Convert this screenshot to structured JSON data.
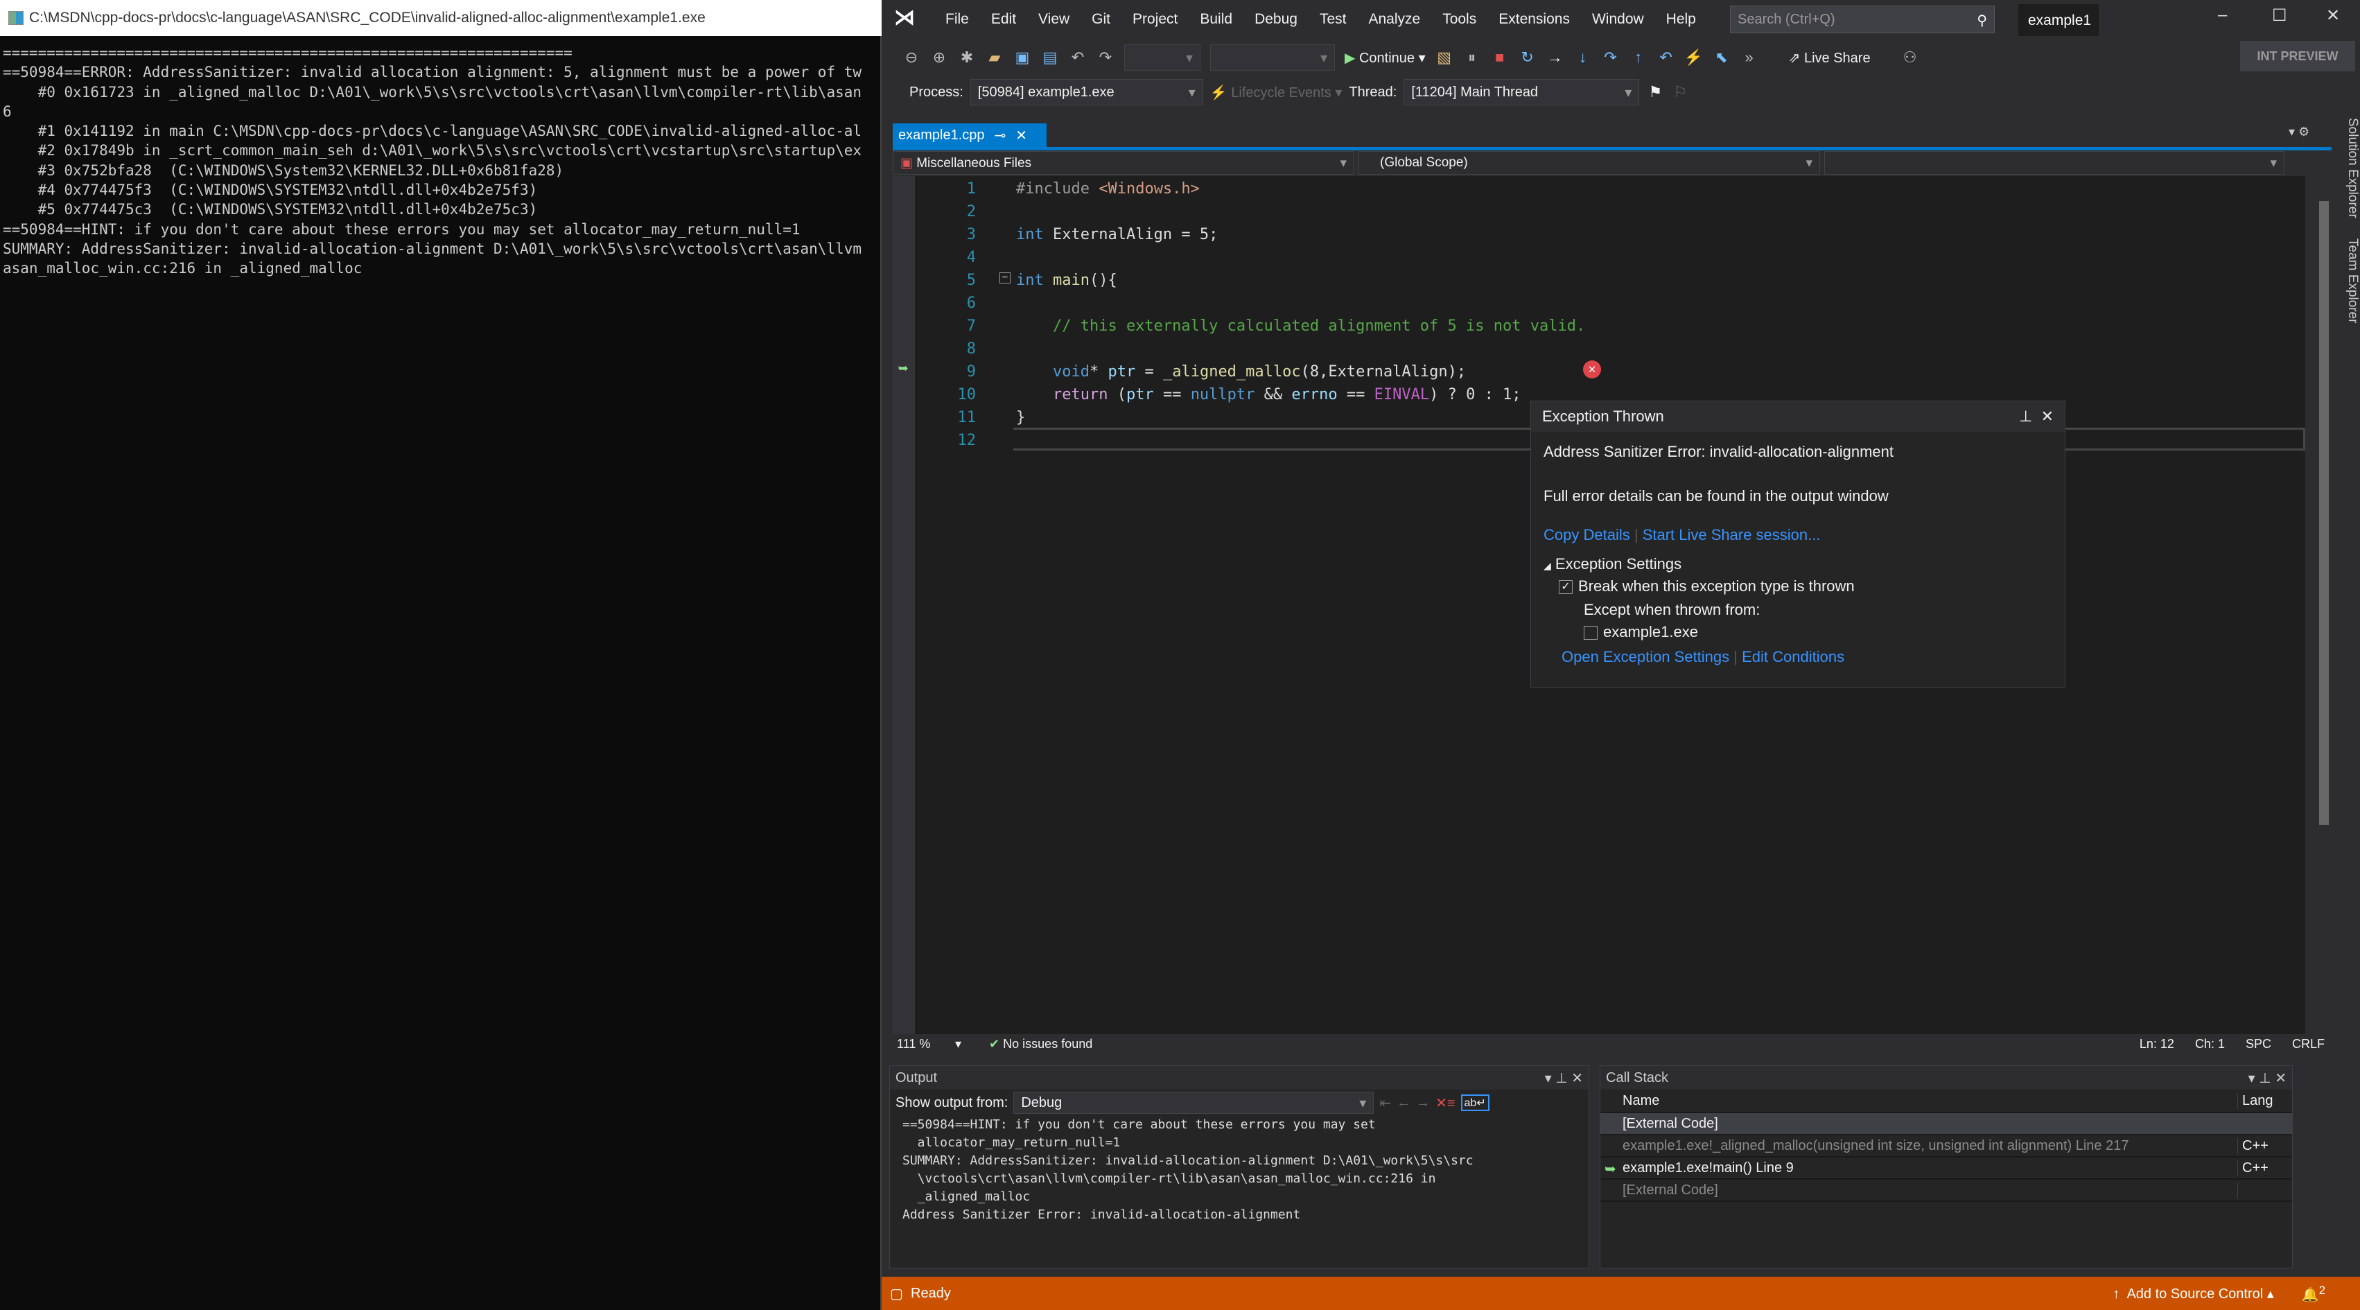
{
  "console": {
    "title": "C:\\MSDN\\cpp-docs-pr\\docs\\c-language\\ASAN\\SRC_CODE\\invalid-aligned-alloc-alignment\\example1.exe",
    "lines": [
      "=================================================================",
      "==50984==ERROR: AddressSanitizer: invalid allocation alignment: 5, alignment must be a power of tw",
      "    #0 0x161723 in _aligned_malloc D:\\A01\\_work\\5\\s\\src\\vctools\\crt\\asan\\llvm\\compiler-rt\\lib\\asan",
      "6",
      "    #1 0x141192 in main C:\\MSDN\\cpp-docs-pr\\docs\\c-language\\ASAN\\SRC_CODE\\invalid-aligned-alloc-al",
      "",
      "    #2 0x17849b in _scrt_common_main_seh d:\\A01\\_work\\5\\s\\src\\vctools\\crt\\vcstartup\\src\\startup\\ex",
      "    #3 0x752bfa28  (C:\\WINDOWS\\System32\\KERNEL32.DLL+0x6b81fa28)",
      "    #4 0x774475f3  (C:\\WINDOWS\\SYSTEM32\\ntdll.dll+0x4b2e75f3)",
      "    #5 0x774475c3  (C:\\WINDOWS\\SYSTEM32\\ntdll.dll+0x4b2e75c3)",
      "",
      "==50984==HINT: if you don't care about these errors you may set allocator_may_return_null=1",
      "SUMMARY: AddressSanitizer: invalid-allocation-alignment D:\\A01\\_work\\5\\s\\src\\vctools\\crt\\asan\\llvm",
      "asan_malloc_win.cc:216 in _aligned_malloc"
    ]
  },
  "vs": {
    "menu": [
      "File",
      "Edit",
      "View",
      "Git",
      "Project",
      "Build",
      "Debug",
      "Test",
      "Analyze",
      "Tools",
      "Extensions",
      "Window",
      "Help"
    ],
    "search_placeholder": "Search (Ctrl+Q)",
    "solution_name": "example1",
    "toolbar": {
      "continue": "Continue",
      "live_share": "Live Share",
      "int_preview": "INT PREVIEW"
    },
    "toolbar2": {
      "process_label": "Process:",
      "process_value": "[50984] example1.exe",
      "lifecycle": "Lifecycle Events",
      "thread_label": "Thread:",
      "thread_value": "[11204] Main Thread"
    },
    "tab": {
      "label": "example1.cpp"
    },
    "navbar": {
      "project": "Miscellaneous Files",
      "scope": "(Global Scope)",
      "member": ""
    },
    "code": [
      [
        [
          "#include ",
          "pp"
        ],
        [
          "<Windows.h>",
          "st"
        ]
      ],
      [],
      [
        [
          "int ",
          "kw"
        ],
        [
          "ExternalAlign = 5;",
          "pl"
        ]
      ],
      [],
      [
        [
          "int ",
          "kw"
        ],
        [
          "main",
          "fn"
        ],
        [
          "(){",
          "pl"
        ]
      ],
      [],
      [
        [
          "    // this externally calculated alignment of 5 is not valid.",
          "cm"
        ]
      ],
      [],
      [
        [
          "    void",
          "kw"
        ],
        [
          "* ",
          "pl"
        ],
        [
          "ptr",
          "id"
        ],
        [
          " = ",
          "pl"
        ],
        [
          "_aligned_malloc",
          "fn"
        ],
        [
          "(8,ExternalAlign);",
          "pl"
        ]
      ],
      [
        [
          "    return ",
          "ctl"
        ],
        [
          "(",
          "pl"
        ],
        [
          "ptr",
          "id"
        ],
        [
          " == ",
          "pl"
        ],
        [
          "nullptr",
          "kw"
        ],
        [
          " && ",
          "pl"
        ],
        [
          "errno",
          "id"
        ],
        [
          " == ",
          "pl"
        ],
        [
          "EINVAL",
          "mac"
        ],
        [
          ") ? 0 : 1;",
          "pl"
        ]
      ],
      [
        [
          "}",
          "pl"
        ]
      ],
      []
    ],
    "editor_status": {
      "zoom": "111 %",
      "issues": "No issues found",
      "ln": "Ln: 12",
      "ch": "Ch: 1",
      "spc": "SPC",
      "crlf": "CRLF"
    },
    "exception": {
      "title": "Exception Thrown",
      "message": "Address Sanitizer Error: invalid-allocation-alignment",
      "details": "Full error details can be found in the output window",
      "copy_details": "Copy Details",
      "live_share": "Start Live Share session...",
      "settings_header": "Exception Settings",
      "break_when": "Break when this exception type is thrown",
      "break_checked": true,
      "except_when": "Except when thrown from:",
      "except_module": "example1.exe",
      "except_checked": false,
      "open_settings": "Open Exception Settings",
      "edit_conditions": "Edit Conditions"
    },
    "output": {
      "title": "Output",
      "show_from_label": "Show output from:",
      "show_from_value": "Debug",
      "lines": [
        "==50984==HINT: if you don't care about these errors you may set",
        "  allocator_may_return_null=1",
        "SUMMARY: AddressSanitizer: invalid-allocation-alignment D:\\A01\\_work\\5\\s\\src",
        "  \\vctools\\crt\\asan\\llvm\\compiler-rt\\lib\\asan\\asan_malloc_win.cc:216 in",
        "  _aligned_malloc",
        "Address Sanitizer Error: invalid-allocation-alignment"
      ]
    },
    "callstack": {
      "title": "Call Stack",
      "col_name": "Name",
      "col_lang": "Lang",
      "rows": [
        {
          "name": "[External Code]",
          "lang": "",
          "dim": false,
          "current": false
        },
        {
          "name": "example1.exe!_aligned_malloc(unsigned int size, unsigned int alignment) Line 217",
          "lang": "C++",
          "dim": true,
          "current": false
        },
        {
          "name": "example1.exe!main() Line 9",
          "lang": "C++",
          "dim": false,
          "current": true
        },
        {
          "name": "[External Code]",
          "lang": "",
          "dim": true,
          "current": false
        }
      ]
    },
    "status": {
      "ready": "Ready",
      "source_control": "Add to Source Control",
      "notifications": "2"
    },
    "side_tabs": [
      "Solution Explorer",
      "Team Explorer"
    ],
    "colors": {
      "accent": "#007acc",
      "status_bar": "#ca5100",
      "editor_bg": "#1e1e1e"
    }
  }
}
